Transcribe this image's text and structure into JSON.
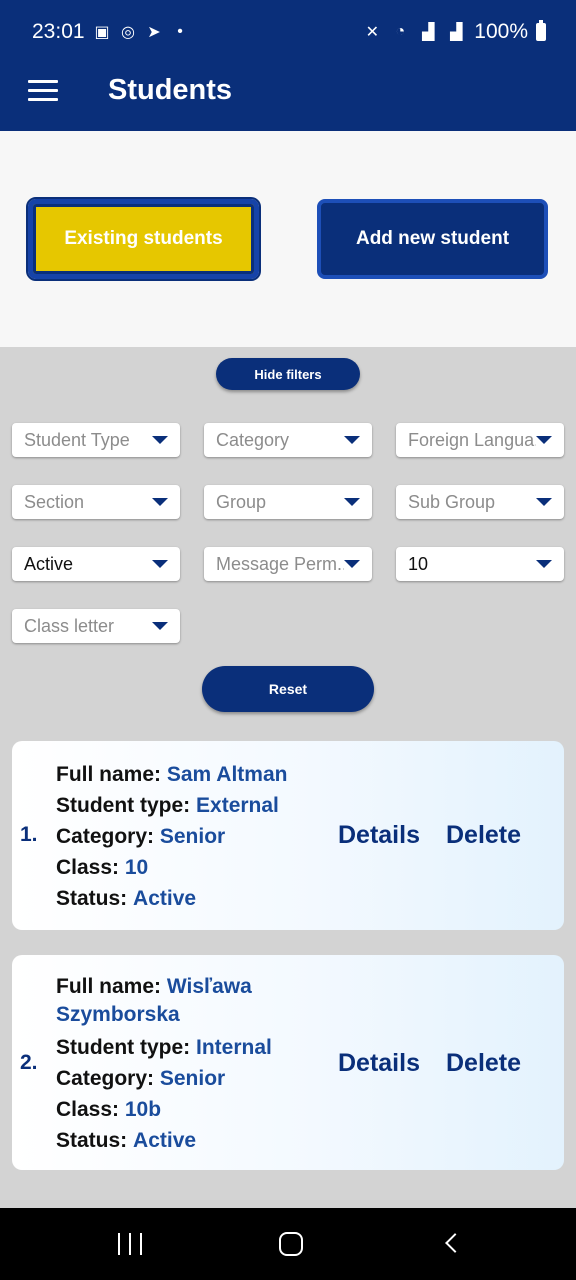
{
  "status_bar": {
    "time": "23:01",
    "battery": "100%",
    "left_icons": [
      "gallery-icon",
      "instagram-icon",
      "telegram-icon",
      "dot-icon"
    ],
    "right_icons": [
      "mute-icon",
      "wifi-icon",
      "signal-icon",
      "signal-icon",
      "battery-icon"
    ]
  },
  "app_bar": {
    "title": "Students",
    "menu_icon": "hamburger-icon"
  },
  "tabs": {
    "existing": "Existing students",
    "add": "Add new student"
  },
  "filters": {
    "hide_label": "Hide filters",
    "reset_label": "Reset",
    "student_type": "Student Type",
    "category": "Category",
    "foreign_language": "Foreign Langua...",
    "section": "Section",
    "group": "Group",
    "sub_group": "Sub Group",
    "status": "Active",
    "message_permission": "Message Perm...",
    "class": "10",
    "class_letter": "Class letter"
  },
  "labels": {
    "full_name": "Full name:",
    "student_type": "Student type:",
    "category": "Category:",
    "class": "Class:",
    "status": "Status:",
    "details": "Details",
    "delete": "Delete"
  },
  "students": [
    {
      "index": "1.",
      "full_name": "Sam Altman",
      "student_type": "External",
      "category": "Senior",
      "class": "10",
      "status": "Active"
    },
    {
      "index": "2.",
      "full_name": "Wisľawa Szymborska",
      "student_type": "Internal",
      "category": "Senior",
      "class": "10b",
      "status": "Active"
    }
  ],
  "colors": {
    "primary": "#0a2f7a",
    "accent": "#e6c700",
    "value_text": "#1a4c9c"
  }
}
